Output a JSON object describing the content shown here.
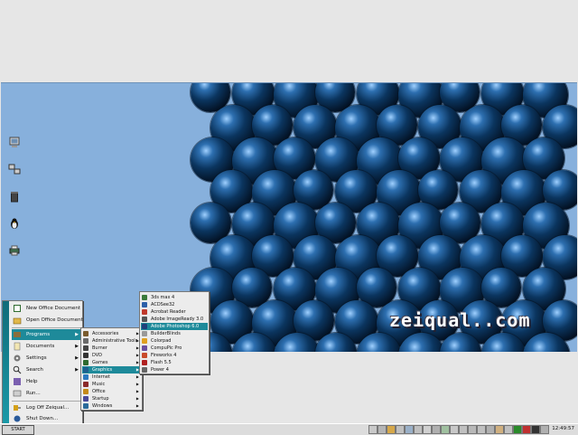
{
  "desktop": {
    "watermark": "zeiqual..com",
    "icons": [
      "computer-icon",
      "network-icon",
      "trash-icon",
      "penguin-icon",
      "printer-icon"
    ]
  },
  "start_menu": {
    "top_items": [
      {
        "label": "New Office Document"
      },
      {
        "label": "Open Office Document"
      }
    ],
    "items": [
      {
        "label": "Programs",
        "has_submenu": true,
        "selected": true
      },
      {
        "label": "Documents",
        "has_submenu": true,
        "selected": false
      },
      {
        "label": "Settings",
        "has_submenu": true,
        "selected": false
      },
      {
        "label": "Search",
        "has_submenu": true,
        "selected": false
      },
      {
        "label": "Help",
        "has_submenu": false,
        "selected": false
      },
      {
        "label": "Run...",
        "has_submenu": false,
        "selected": false
      }
    ],
    "bottom_items": [
      {
        "label": "Log Off Zeiqual..."
      },
      {
        "label": "Shut Down..."
      }
    ]
  },
  "programs_menu": [
    {
      "label": "Accessories",
      "selected": false
    },
    {
      "label": "Administrative Tools",
      "selected": false
    },
    {
      "label": "Burner",
      "selected": false
    },
    {
      "label": "DVD",
      "selected": false
    },
    {
      "label": "Games",
      "selected": false
    },
    {
      "label": "Graphics",
      "selected": true
    },
    {
      "label": "Internet",
      "selected": false
    },
    {
      "label": "Music",
      "selected": false
    },
    {
      "label": "Office",
      "selected": false
    },
    {
      "label": "Startup",
      "selected": false
    },
    {
      "label": "Windows",
      "selected": false
    }
  ],
  "graphics_menu": [
    {
      "label": "3ds max 4",
      "selected": false,
      "color": "#3a7a3a"
    },
    {
      "label": "ACDSee32",
      "selected": false,
      "color": "#2c5fa8"
    },
    {
      "label": "Acrobat Reader",
      "selected": false,
      "color": "#c0392b"
    },
    {
      "label": "Adobe ImageReady 3.0",
      "selected": false,
      "color": "#555555"
    },
    {
      "label": "Adobe Photoshop 6.0",
      "selected": true,
      "color": "#1f3f7a"
    },
    {
      "label": "BuilderBlinds",
      "selected": false,
      "color": "#999999"
    },
    {
      "label": "Colorpad",
      "selected": false,
      "color": "#e0a020"
    },
    {
      "label": "CompuPic Pro",
      "selected": false,
      "color": "#6b4fa0"
    },
    {
      "label": "Fireworks 4",
      "selected": false,
      "color": "#c84a2a"
    },
    {
      "label": "Flash 5.5",
      "selected": false,
      "color": "#b02020"
    },
    {
      "label": "Power 4",
      "selected": false,
      "color": "#666666"
    }
  ],
  "taskbar": {
    "start_label": "START",
    "clock": "12:49:57"
  }
}
